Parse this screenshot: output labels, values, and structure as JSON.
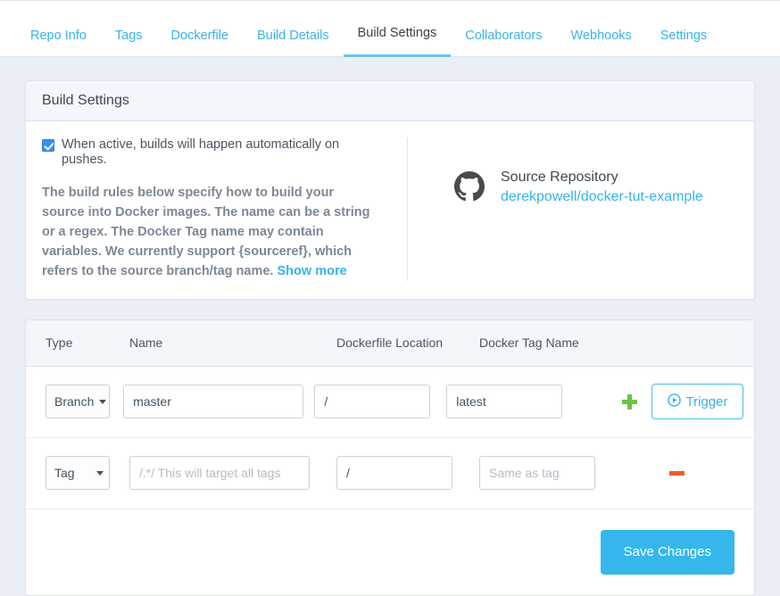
{
  "tabs": [
    {
      "label": "Repo Info",
      "active": false
    },
    {
      "label": "Tags",
      "active": false
    },
    {
      "label": "Dockerfile",
      "active": false
    },
    {
      "label": "Build Details",
      "active": false
    },
    {
      "label": "Build Settings",
      "active": true
    },
    {
      "label": "Collaborators",
      "active": false
    },
    {
      "label": "Webhooks",
      "active": false
    },
    {
      "label": "Settings",
      "active": false
    }
  ],
  "panel": {
    "title": "Build Settings",
    "autobuild_label": "When active, builds will happen automatically on pushes.",
    "autobuild_checked": true,
    "blurb": "The build rules below specify how to build your source into Docker images. The name can be a string or a regex. The Docker Tag name may contain variables. We currently support {sourceref}, which refers to the source branch/tag name.",
    "show_more": "Show more",
    "source_repository_title": "Source Repository",
    "source_repository_link": "derekpowell/docker-tut-example",
    "source_icon": "github-icon"
  },
  "rules_table": {
    "columns": [
      "Type",
      "Name",
      "Dockerfile Location",
      "Docker Tag Name"
    ],
    "rows": [
      {
        "type": "Branch",
        "name_value": "master",
        "name_placeholder": "",
        "location_value": "/",
        "location_placeholder": "",
        "tag_value": "latest",
        "tag_placeholder": "",
        "action": "add",
        "trigger_label": "Trigger"
      },
      {
        "type": "Tag",
        "name_value": "",
        "name_placeholder": "/.*/ This will target all tags",
        "location_value": "/",
        "location_placeholder": "",
        "tag_value": "",
        "tag_placeholder": "Same as tag",
        "action": "remove"
      }
    ]
  },
  "footer": {
    "save_label": "Save Changes"
  },
  "colors": {
    "accent": "#39b3e8",
    "save_button": "#35b7ec",
    "add": "#6cc24a",
    "remove": "#f15a29",
    "page_background": "#eaeff5",
    "panel_header": "#f3f7fb"
  }
}
